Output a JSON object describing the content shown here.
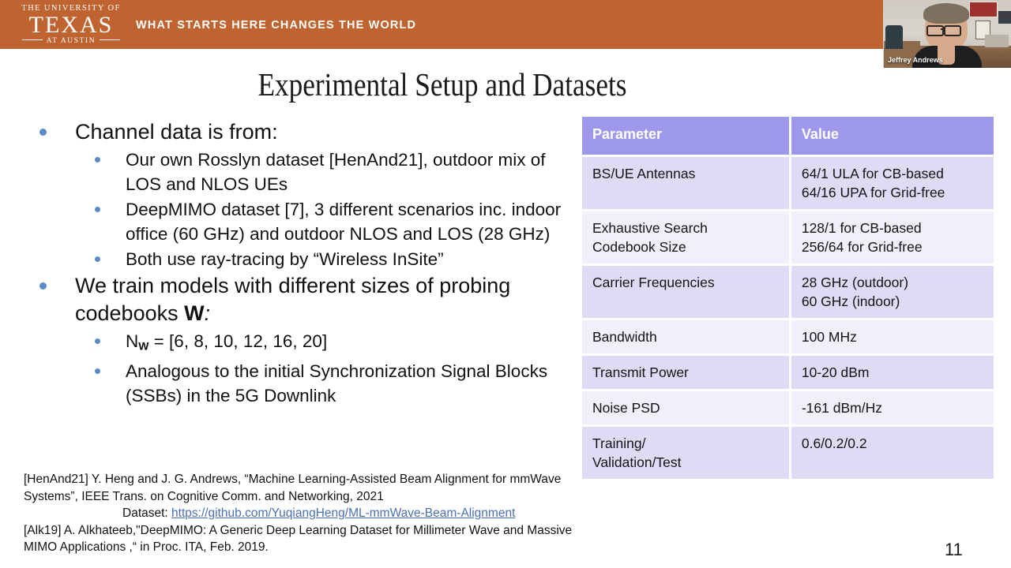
{
  "banner": {
    "logo_line1": "THE UNIVERSITY OF",
    "logo_main": "TEXAS",
    "logo_line3": "AT AUSTIN",
    "tagline": "WHAT STARTS HERE CHANGES THE WORLD",
    "color": "#bf6330"
  },
  "webcam": {
    "participant_name": "Jeffrey Andrews"
  },
  "slide": {
    "title": "Experimental Setup and Datasets",
    "page_number": "11",
    "bullet_color": "#5b8bc4"
  },
  "bullets": [
    {
      "level": 1,
      "text": "Channel data is from:"
    },
    {
      "level": 2,
      "text": "Our own Rosslyn dataset [HenAnd21], outdoor mix of LOS and NLOS UEs"
    },
    {
      "level": 2,
      "text": "DeepMIMO dataset [7], 3 different scenarios inc. indoor office (60 GHz) and outdoor NLOS and LOS (28 GHz)"
    },
    {
      "level": 2,
      "text": "Both use ray-tracing by “Wireless InSite”"
    },
    {
      "level": 1,
      "text_pre": "We train models with different sizes of probing codebooks ",
      "text_bold": "W",
      "text_post": ":"
    },
    {
      "level": 2,
      "text_pre": "N",
      "text_sub": "W",
      "text_post": " = [6, 8, 10, 12, 16, 20]"
    },
    {
      "level": 2,
      "text": "Analogous to the initial Synchronization Signal Blocks (SSBs) in the 5G Downlink"
    }
  ],
  "footnotes": {
    "line1": "[HenAnd21] Y. Heng and J. G. Andrews, “Machine Learning-Assisted Beam Alignment for mmWave Systems”, IEEE Trans. on Cognitive Comm. and Networking, 2021",
    "dataset_label": "Dataset: ",
    "dataset_url": "https://github.com/YuqiangHeng/ML-mmWave-Beam-Alignment",
    "line2": "[Alk19] A. Alkhateeb,\"DeepMIMO: A Generic Deep Learning Dataset for Millimeter Wave and Massive MIMO Applications ,“ in Proc. ITA, Feb. 2019."
  },
  "table": {
    "header_color": "#9e98ea",
    "band_a_color": "#dedcf4",
    "band_b_color": "#f0effa",
    "headers": [
      "Parameter",
      "Value"
    ],
    "rows": [
      {
        "parameter": "BS/UE Antennas",
        "value": "64/1 ULA for CB-based\n64/16 UPA for Grid-free"
      },
      {
        "parameter": "Exhaustive Search\nCodebook Size",
        "value": "128/1 for CB-based\n256/64 for Grid-free"
      },
      {
        "parameter": "Carrier Frequencies",
        "value": "28 GHz (outdoor)\n60 GHz (indoor)"
      },
      {
        "parameter": "Bandwidth",
        "value": "100 MHz"
      },
      {
        "parameter": "Transmit Power",
        "value": "10-20 dBm"
      },
      {
        "parameter": "Noise PSD",
        "value": "-161 dBm/Hz"
      },
      {
        "parameter": "Training/\nValidation/Test",
        "value": "0.6/0.2/0.2"
      }
    ]
  }
}
